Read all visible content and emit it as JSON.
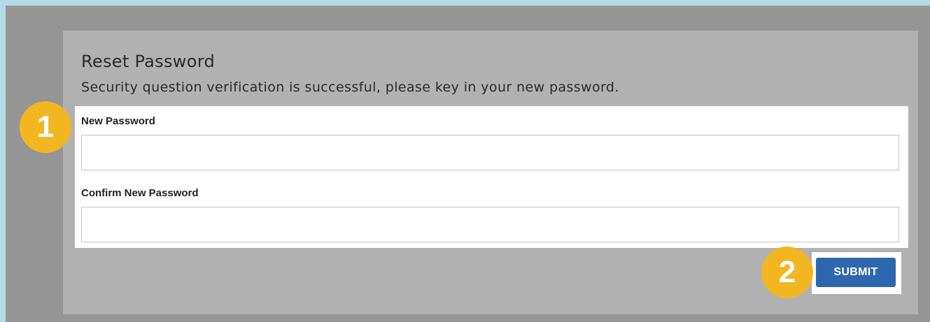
{
  "dialog": {
    "title": "Reset Password",
    "subtitle": "Security question verification is successful, please key in your new password."
  },
  "form": {
    "new_password": {
      "label": "New Password",
      "value": "",
      "placeholder": ""
    },
    "confirm_password": {
      "label": "Confirm New Password",
      "value": "",
      "placeholder": ""
    },
    "submit_label": "SUBMIT"
  },
  "annotations": {
    "step1": "1",
    "step2": "2"
  },
  "colors": {
    "accent": "#2f67ae",
    "badge": "#f2b620",
    "backdrop": "#959595",
    "dialog": "#b1b1b1",
    "frame": "#b3dbe6"
  }
}
